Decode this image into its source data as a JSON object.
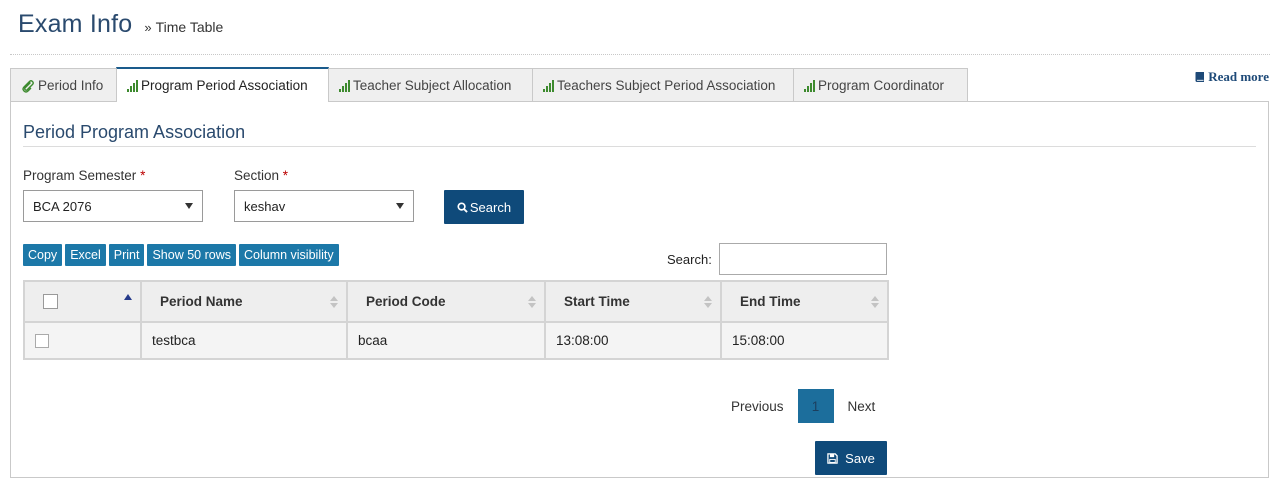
{
  "header": {
    "title": "Exam Info",
    "separator": "»",
    "breadcrumb": "Time Table"
  },
  "read_more": {
    "label": "Read more",
    "icon": "book-icon"
  },
  "tabs": [
    {
      "label": "Period Info",
      "icon": "paperclip-icon",
      "active": false
    },
    {
      "label": "Program Period Association",
      "icon": "signal-bars-icon",
      "active": true
    },
    {
      "label": "Teacher Subject Allocation",
      "icon": "signal-bars-icon",
      "active": false
    },
    {
      "label": "Teachers Subject Period Association",
      "icon": "signal-bars-icon",
      "active": false
    },
    {
      "label": "Program Coordinator",
      "icon": "signal-bars-icon",
      "active": false
    }
  ],
  "section": {
    "title": "Period Program Association"
  },
  "form": {
    "program_semester": {
      "label": "Program Semester",
      "required": "*",
      "value": "BCA 2076"
    },
    "section": {
      "label": "Section",
      "required": "*",
      "value": "keshav"
    },
    "search_button": "Search"
  },
  "table_tools": {
    "buttons": [
      "Copy",
      "Excel",
      "Print",
      "Show 50 rows",
      "Column visibility"
    ],
    "search_label": "Search:",
    "search_value": ""
  },
  "table": {
    "columns": [
      "",
      "Period Name",
      "Period Code",
      "Start Time",
      "End Time"
    ],
    "rows": [
      {
        "checked": false,
        "period_name": "testbca",
        "period_code": "bcaa",
        "start_time": "13:08:00",
        "end_time": "15:08:00"
      }
    ]
  },
  "pagination": {
    "previous": "Previous",
    "current_page": "1",
    "next": "Next"
  },
  "save_button": "Save",
  "colors": {
    "primary": "#0f4a7a",
    "tool_button": "#1c78a8",
    "title": "#2a4a6e",
    "icon_green": "#3d8a2e"
  }
}
